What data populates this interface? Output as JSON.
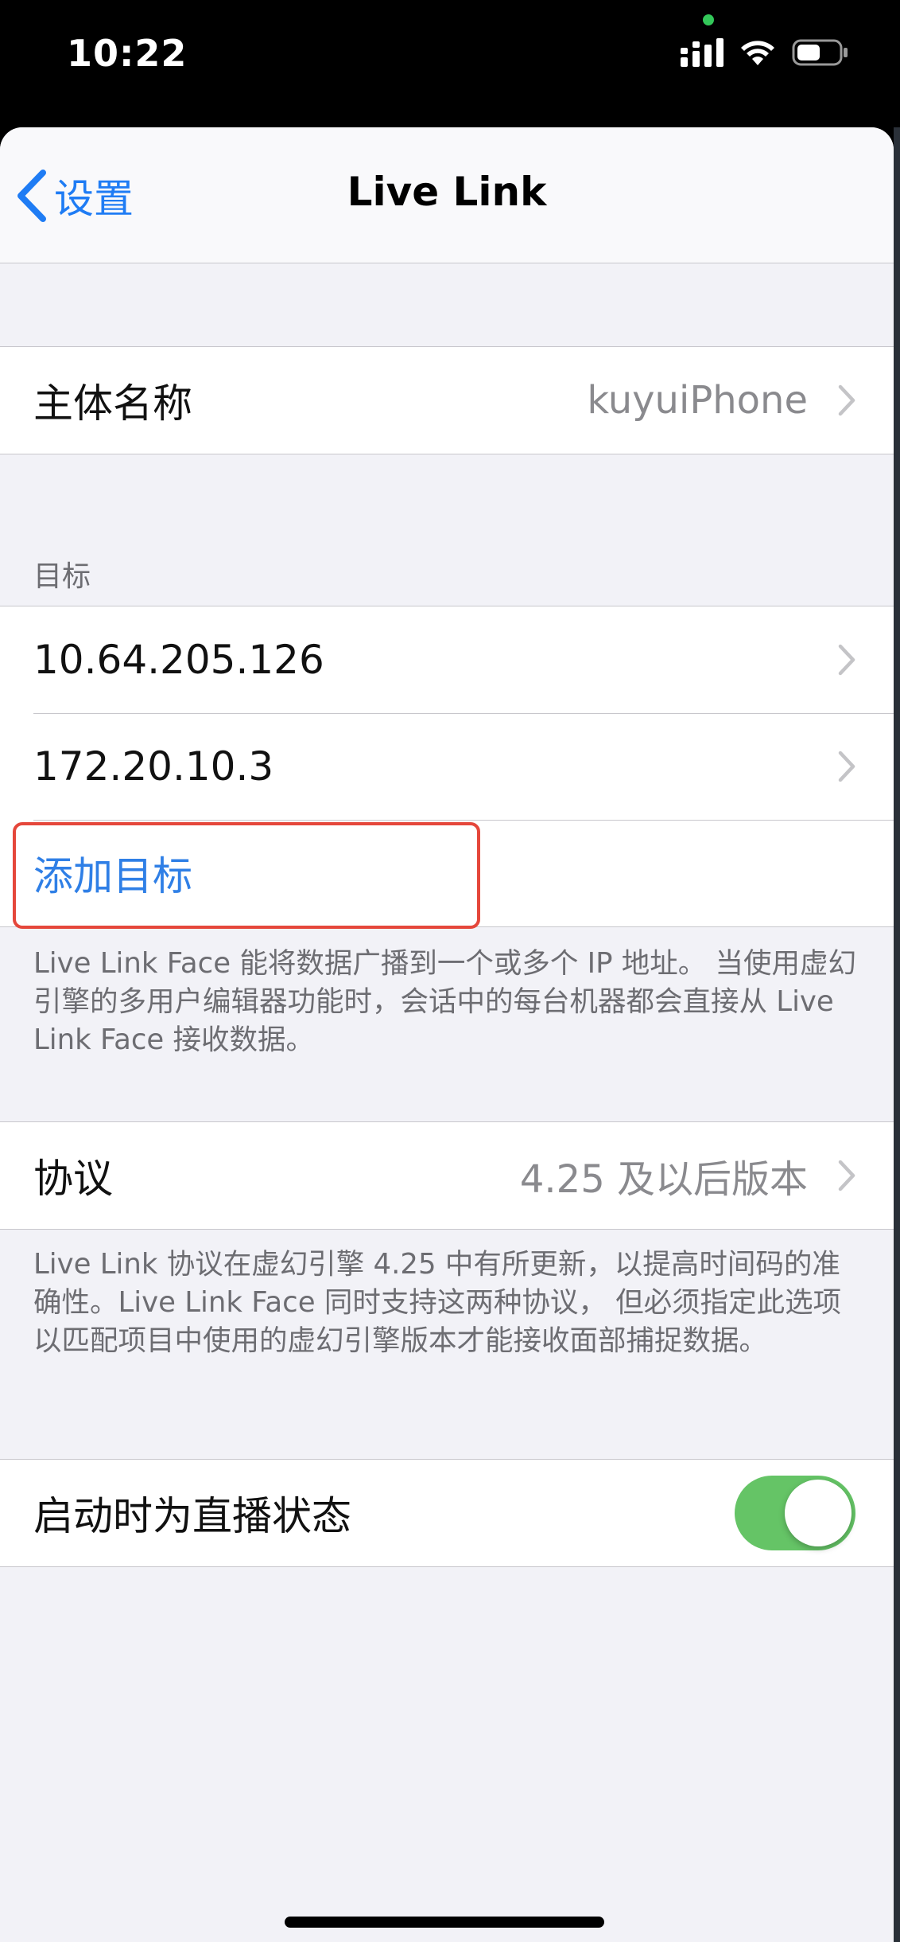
{
  "status_bar": {
    "time": "10:22"
  },
  "nav": {
    "back_label": "设置",
    "title": "Live Link"
  },
  "subject": {
    "label": "主体名称",
    "value": "kuyuiPhone"
  },
  "targets": {
    "header": "目标",
    "items": [
      {
        "label": "10.64.205.126"
      },
      {
        "label": "172.20.10.3"
      }
    ],
    "add_label": "添加目标",
    "footer": "Live Link Face 能将数据广播到一个或多个 IP 地址。 当使用虚幻引擎的多用户编辑器功能时，会话中的每台机器都会直接从 Live Link Face 接收数据。"
  },
  "protocol": {
    "label": "协议",
    "value": "4.25 及以后版本",
    "footer": "Live Link 协议在虚幻引擎 4.25 中有所更新，以提高时间码的准确性。Live Link Face 同时支持这两种协议， 但必须指定此选项以匹配项目中使用的虚幻引擎版本才能接收面部捕捉数据。"
  },
  "startup": {
    "label": "启动时为直播状态",
    "toggle_on": true
  },
  "colors": {
    "accent": "#2f7fe6",
    "toggle_on": "#65c466",
    "highlight": "#e5473b",
    "background": "#f2f2f7"
  },
  "icons": [
    "cellular-signal-icon",
    "wifi-icon",
    "battery-icon",
    "back-chevron-icon",
    "chevron-right-icon"
  ]
}
